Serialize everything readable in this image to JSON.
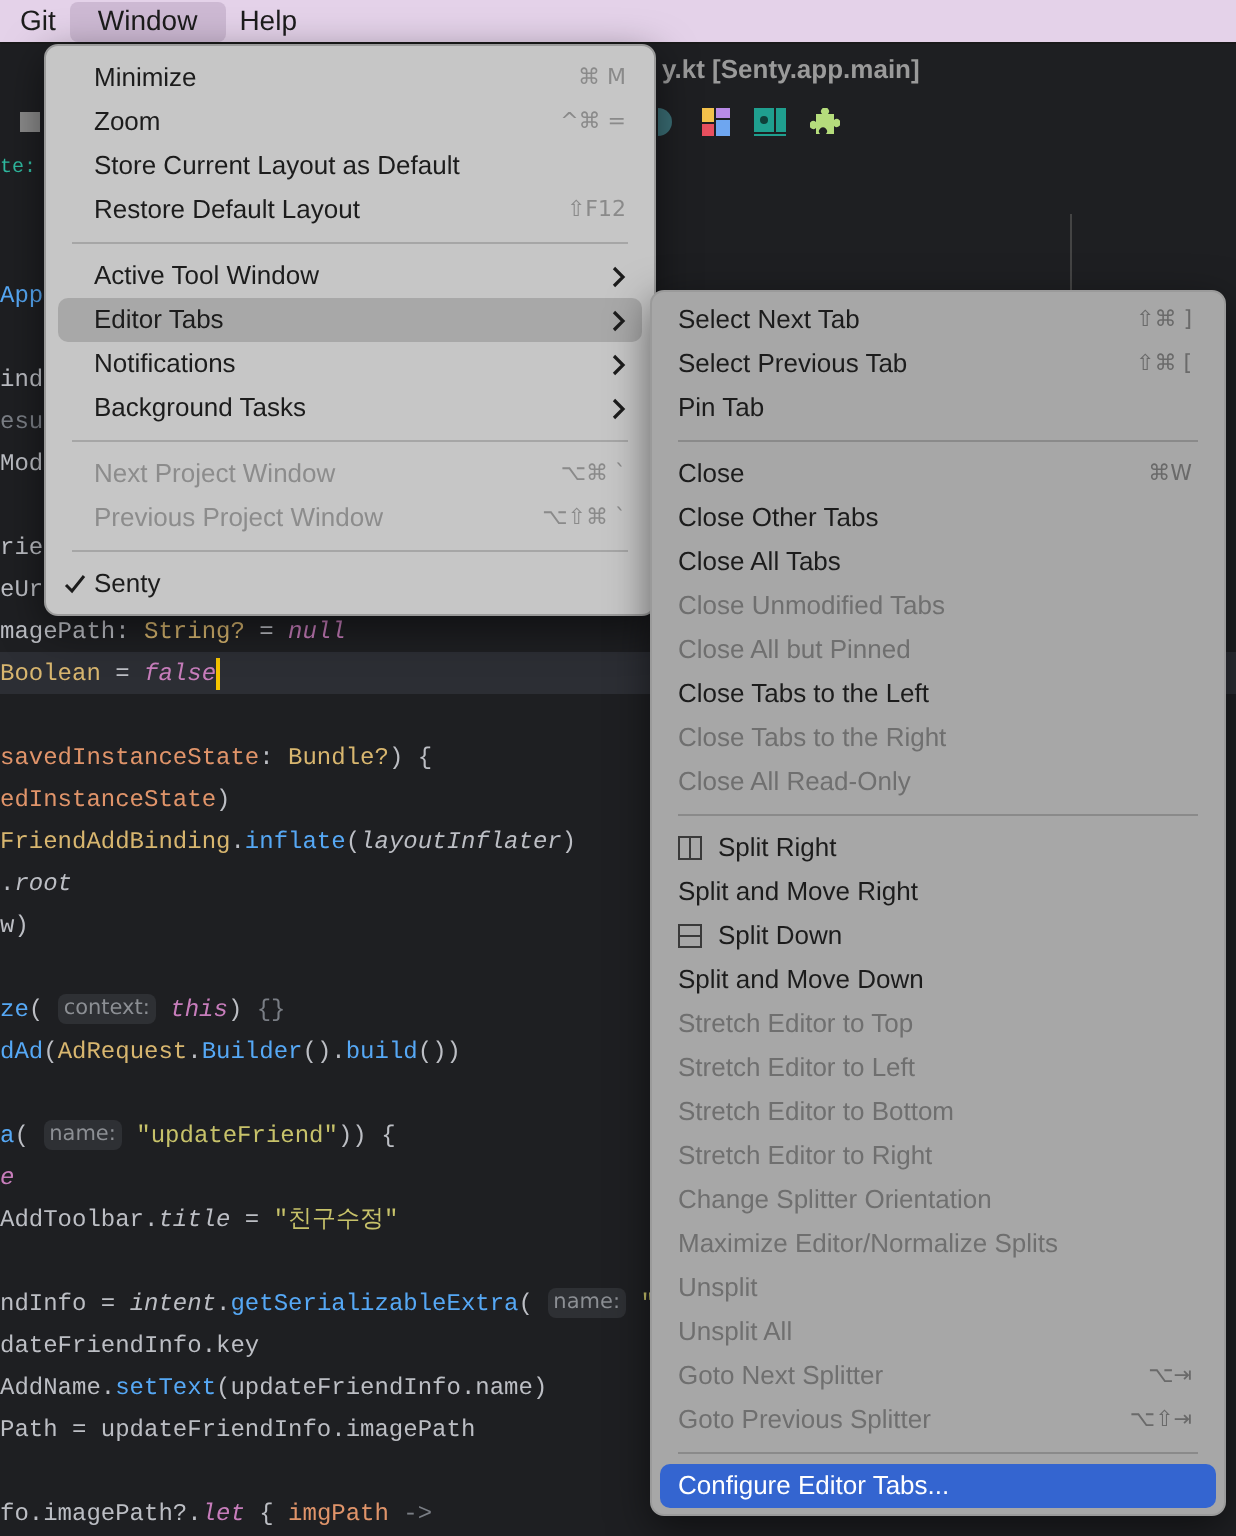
{
  "menubar": [
    {
      "label": "Git",
      "selected": false
    },
    {
      "label": "Window",
      "selected": true
    },
    {
      "label": "Help",
      "selected": false
    }
  ],
  "editor": {
    "title": "y.kt [Senty.app.main]",
    "lines": [
      {
        "current": false,
        "segments": [
          {
            "kind": "teal",
            "text": "te:"
          }
        ]
      },
      {
        "current": false
      },
      {
        "current": false
      },
      {
        "current": false,
        "segments": [
          {
            "kind": "fn",
            "text": "App"
          }
        ]
      },
      {
        "current": false
      },
      {
        "current": false,
        "segments": [
          {
            "kind": "plain",
            "text": "ind"
          }
        ]
      },
      {
        "current": false,
        "segments": [
          {
            "kind": "dim",
            "text": "esu"
          }
        ]
      },
      {
        "current": false,
        "segments": [
          {
            "kind": "plain",
            "text": "Mod"
          }
        ]
      },
      {
        "current": false
      },
      {
        "current": false,
        "segments": [
          {
            "kind": "plain",
            "text": "rie"
          }
        ]
      },
      {
        "current": false,
        "segments": [
          {
            "kind": "plain",
            "text": "eUr"
          }
        ]
      },
      {
        "current": false,
        "segments": [
          {
            "kind": "plain",
            "text": "magePath: "
          },
          {
            "kind": "type",
            "text": "String?"
          },
          {
            "kind": "plain",
            "text": " = "
          },
          {
            "kind": "lit",
            "text": "null"
          }
        ]
      },
      {
        "current": true,
        "segments": [
          {
            "kind": "type",
            "text": "Boolean"
          },
          {
            "kind": "plain",
            "text": " = "
          },
          {
            "kind": "lit",
            "text": "false"
          }
        ]
      },
      {
        "current": false
      },
      {
        "current": false,
        "segments": [
          {
            "kind": "kw",
            "text": "savedInstanceState"
          },
          {
            "kind": "plain",
            "text": ": "
          },
          {
            "kind": "type",
            "text": "Bundle?"
          },
          {
            "kind": "plain",
            "text": ") {"
          }
        ]
      },
      {
        "current": false,
        "segments": [
          {
            "kind": "kw",
            "text": "edInstanceState"
          },
          {
            "kind": "plain",
            "text": ")"
          }
        ]
      },
      {
        "current": false,
        "segments": [
          {
            "kind": "type",
            "text": "FriendAddBinding"
          },
          {
            "kind": "plain",
            "text": "."
          },
          {
            "kind": "fn",
            "text": "inflate"
          },
          {
            "kind": "plain",
            "text": "("
          },
          {
            "kind": "italic",
            "text": "layoutInflater"
          },
          {
            "kind": "plain",
            "text": ")"
          }
        ]
      },
      {
        "current": false,
        "segments": [
          {
            "kind": "plain",
            "text": "."
          },
          {
            "kind": "italic",
            "text": "root"
          }
        ]
      },
      {
        "current": false,
        "segments": [
          {
            "kind": "plain",
            "text": "w)"
          }
        ]
      },
      {
        "current": false
      },
      {
        "current": false,
        "segments": [
          {
            "kind": "fn",
            "text": "ze"
          },
          {
            "kind": "plain",
            "text": "( "
          },
          {
            "kind": "hint",
            "text": "context:"
          },
          {
            "kind": "lit",
            "text": " this"
          },
          {
            "kind": "plain",
            "text": ") "
          },
          {
            "kind": "dim",
            "text": "{}"
          }
        ]
      },
      {
        "current": false,
        "segments": [
          {
            "kind": "fn",
            "text": "dAd"
          },
          {
            "kind": "plain",
            "text": "("
          },
          {
            "kind": "type",
            "text": "AdRequest"
          },
          {
            "kind": "plain",
            "text": "."
          },
          {
            "kind": "fn",
            "text": "Builder"
          },
          {
            "kind": "plain",
            "text": "()."
          },
          {
            "kind": "fn",
            "text": "build"
          },
          {
            "kind": "plain",
            "text": "())"
          }
        ]
      },
      {
        "current": false
      },
      {
        "current": false,
        "segments": [
          {
            "kind": "fn",
            "text": "a"
          },
          {
            "kind": "plain",
            "text": "( "
          },
          {
            "kind": "hint",
            "text": "name:"
          },
          {
            "kind": "str",
            "text": " \"updateFriend\""
          },
          {
            "kind": "plain",
            "text": ")) {"
          }
        ]
      },
      {
        "current": false,
        "segments": [
          {
            "kind": "lit",
            "text": "e"
          }
        ]
      },
      {
        "current": false,
        "segments": [
          {
            "kind": "plain",
            "text": "AddToolbar."
          },
          {
            "kind": "italic",
            "text": "title"
          },
          {
            "kind": "plain",
            "text": " = "
          },
          {
            "kind": "str",
            "text": "\"친구수정\""
          }
        ]
      },
      {
        "current": false
      },
      {
        "current": false,
        "segments": [
          {
            "kind": "plain",
            "text": "ndInfo = "
          },
          {
            "kind": "italic",
            "text": "intent"
          },
          {
            "kind": "plain",
            "text": "."
          },
          {
            "kind": "fn",
            "text": "getSerializableExtra"
          },
          {
            "kind": "plain",
            "text": "( "
          },
          {
            "kind": "hint",
            "text": "name:"
          },
          {
            "kind": "str",
            "text": " \""
          }
        ]
      },
      {
        "current": false,
        "segments": [
          {
            "kind": "plain",
            "text": "dateFriendInfo.key"
          }
        ]
      },
      {
        "current": false,
        "segments": [
          {
            "kind": "plain",
            "text": "AddName."
          },
          {
            "kind": "fn",
            "text": "setText"
          },
          {
            "kind": "plain",
            "text": "(updateFriendInfo.name)"
          }
        ]
      },
      {
        "current": false,
        "segments": [
          {
            "kind": "plain",
            "text": "Path = updateFriendInfo.imagePath"
          }
        ]
      },
      {
        "current": false
      },
      {
        "current": false,
        "segments": [
          {
            "kind": "plain",
            "text": "fo.imagePath?."
          },
          {
            "kind": "lit",
            "text": "let"
          },
          {
            "kind": "plain",
            "text": " { "
          },
          {
            "kind": "kw",
            "text": "imgPath"
          },
          {
            "kind": "dim",
            "text": " ->"
          }
        ]
      }
    ]
  },
  "window_menu": {
    "sections": [
      {
        "items": [
          {
            "label": "Minimize",
            "shortcut": "⌘ M",
            "kind": "plain",
            "disabled": false,
            "checked": false,
            "selected": false
          },
          {
            "label": "Zoom",
            "shortcut": "^⌘ =",
            "kind": "plain",
            "disabled": false,
            "checked": false,
            "selected": false
          },
          {
            "label": "Store Current Layout as Default",
            "kind": "plain",
            "disabled": false,
            "checked": false,
            "selected": false
          },
          {
            "label": "Restore Default Layout",
            "shortcut": "⇧F12",
            "kind": "plain",
            "disabled": false,
            "checked": false,
            "selected": false
          }
        ]
      },
      {
        "items": [
          {
            "label": "Active Tool Window",
            "kind": "submenu",
            "disabled": false,
            "checked": false,
            "selected": false
          },
          {
            "label": "Editor Tabs",
            "kind": "submenu",
            "disabled": false,
            "checked": false,
            "selected": true
          },
          {
            "label": "Notifications",
            "kind": "submenu",
            "disabled": false,
            "checked": false,
            "selected": false
          },
          {
            "label": "Background Tasks",
            "kind": "submenu",
            "disabled": false,
            "checked": false,
            "selected": false
          }
        ]
      },
      {
        "items": [
          {
            "label": "Next Project Window",
            "shortcut": "⌥⌘ `",
            "kind": "plain",
            "disabled": true,
            "checked": false,
            "selected": false
          },
          {
            "label": "Previous Project Window",
            "shortcut": "⌥⇧⌘ `",
            "kind": "plain",
            "disabled": true,
            "checked": false,
            "selected": false
          }
        ]
      },
      {
        "items": [
          {
            "label": "Senty",
            "kind": "plain",
            "disabled": false,
            "checked": true,
            "selected": false
          }
        ]
      }
    ]
  },
  "editor_tabs_menu": {
    "sections": [
      {
        "items": [
          {
            "label": "Select Next Tab",
            "shortcut": "⇧⌘ ]",
            "kind": "plain",
            "disabled": false,
            "selected": false
          },
          {
            "label": "Select Previous Tab",
            "shortcut": "⇧⌘ [",
            "kind": "plain",
            "disabled": false,
            "selected": false
          },
          {
            "label": "Pin Tab",
            "kind": "plain",
            "disabled": false,
            "selected": false
          }
        ]
      },
      {
        "items": [
          {
            "label": "Close",
            "shortcut": "⌘W",
            "kind": "plain",
            "disabled": false,
            "selected": false
          },
          {
            "label": "Close Other Tabs",
            "kind": "plain",
            "disabled": false,
            "selected": false
          },
          {
            "label": "Close All Tabs",
            "kind": "plain",
            "disabled": false,
            "selected": false
          },
          {
            "label": "Close Unmodified Tabs",
            "kind": "plain",
            "disabled": true,
            "selected": false
          },
          {
            "label": "Close All but Pinned",
            "kind": "plain",
            "disabled": true,
            "selected": false
          },
          {
            "label": "Close Tabs to the Left",
            "kind": "plain",
            "disabled": false,
            "selected": false
          },
          {
            "label": "Close Tabs to the Right",
            "kind": "plain",
            "disabled": true,
            "selected": false
          },
          {
            "label": "Close All Read-Only",
            "kind": "plain",
            "disabled": true,
            "selected": false
          }
        ]
      },
      {
        "items": [
          {
            "label": "Split Right",
            "kind": "vsplit",
            "disabled": false,
            "selected": false
          },
          {
            "label": "Split and Move Right",
            "kind": "plain",
            "disabled": false,
            "selected": false
          },
          {
            "label": "Split Down",
            "kind": "hsplit",
            "disabled": false,
            "selected": false
          },
          {
            "label": "Split and Move Down",
            "kind": "plain",
            "disabled": false,
            "selected": false
          },
          {
            "label": "Stretch Editor to Top",
            "kind": "plain",
            "disabled": true,
            "selected": false
          },
          {
            "label": "Stretch Editor to Left",
            "kind": "plain",
            "disabled": true,
            "selected": false
          },
          {
            "label": "Stretch Editor to Bottom",
            "kind": "plain",
            "disabled": true,
            "selected": false
          },
          {
            "label": "Stretch Editor to Right",
            "kind": "plain",
            "disabled": true,
            "selected": false
          },
          {
            "label": "Change Splitter Orientation",
            "kind": "plain",
            "disabled": true,
            "selected": false
          },
          {
            "label": "Maximize Editor/Normalize Splits",
            "kind": "plain",
            "disabled": true,
            "selected": false
          },
          {
            "label": "Unsplit",
            "kind": "plain",
            "disabled": true,
            "selected": false
          },
          {
            "label": "Unsplit All",
            "kind": "plain",
            "disabled": true,
            "selected": false
          },
          {
            "label": "Goto Next Splitter",
            "shortcut": "⌥⇥",
            "kind": "plain",
            "disabled": true,
            "selected": false
          },
          {
            "label": "Goto Previous Splitter",
            "shortcut": "⌥⇧⇥",
            "kind": "plain",
            "disabled": true,
            "selected": false
          }
        ]
      },
      {
        "items": [
          {
            "label": "Configure Editor Tabs...",
            "kind": "plain",
            "disabled": false,
            "selected": true
          }
        ]
      }
    ]
  }
}
